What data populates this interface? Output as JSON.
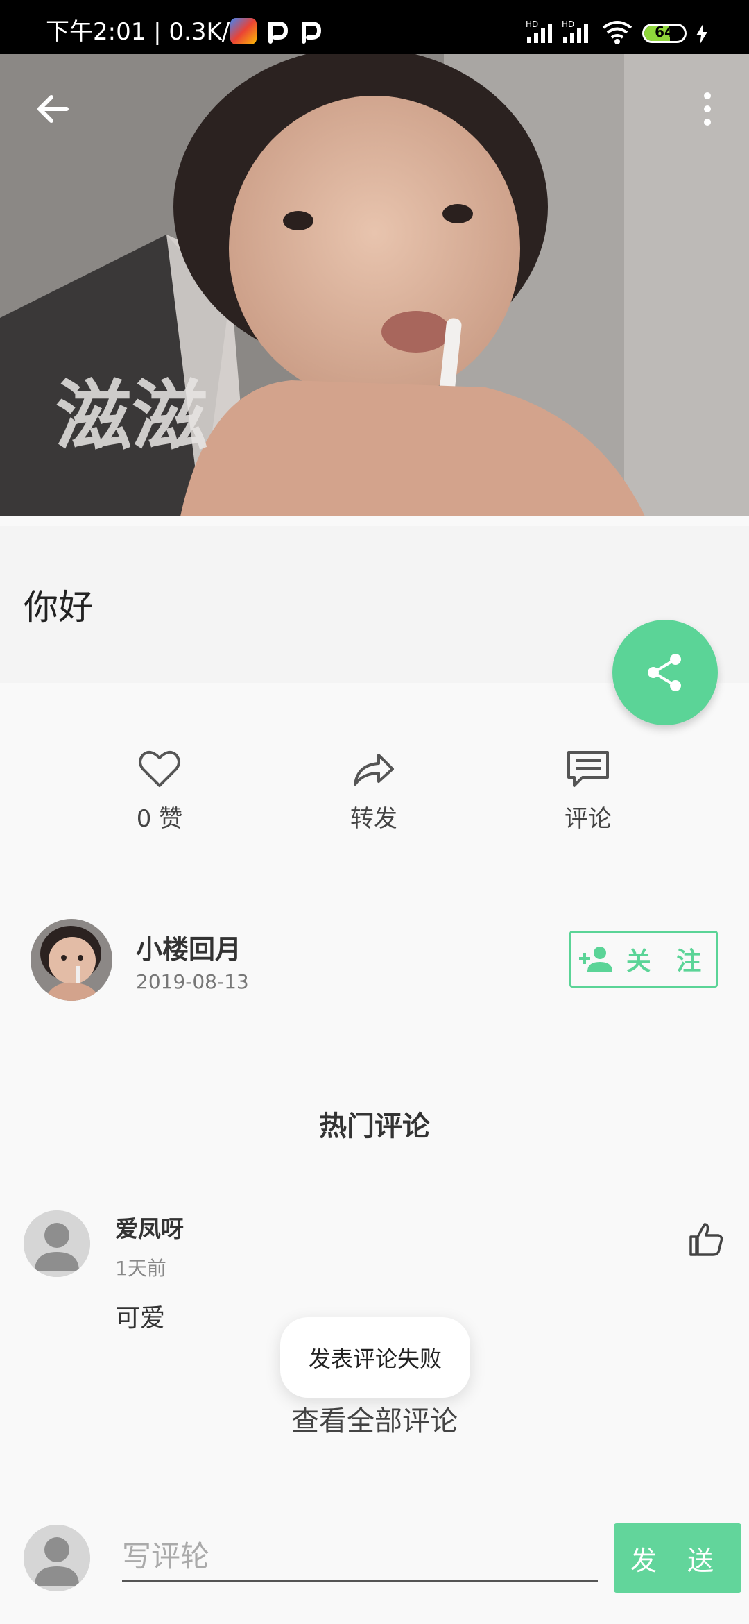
{
  "status_bar": {
    "time_speed": "下午2:01 | 0.3K/s",
    "network_labels": [
      "HD",
      "HD"
    ],
    "battery": "64"
  },
  "toolbar": {
    "back_icon": "arrow-left-icon",
    "more_icon": "more-vertical-icon"
  },
  "hero": {
    "caption_art": "滋滋"
  },
  "post": {
    "title": "你好"
  },
  "actions": {
    "like_label": "0 赞",
    "repost_label": "转发",
    "comment_label": "评论"
  },
  "author": {
    "name": "小楼回月",
    "date": "2019-08-13",
    "follow_label": "关 注"
  },
  "comments": {
    "section_title": "热门评论",
    "items": [
      {
        "user": "爱凤呀",
        "time": "1天前",
        "text": "可爱"
      }
    ],
    "view_all": "查看全部评论"
  },
  "toast": {
    "message": "发表评论失败"
  },
  "compose": {
    "placeholder": "写评轮",
    "send_label": "发 送"
  },
  "colors": {
    "accent": "#5bd497",
    "status_bar": "#000000",
    "background": "#f9f9f9"
  }
}
